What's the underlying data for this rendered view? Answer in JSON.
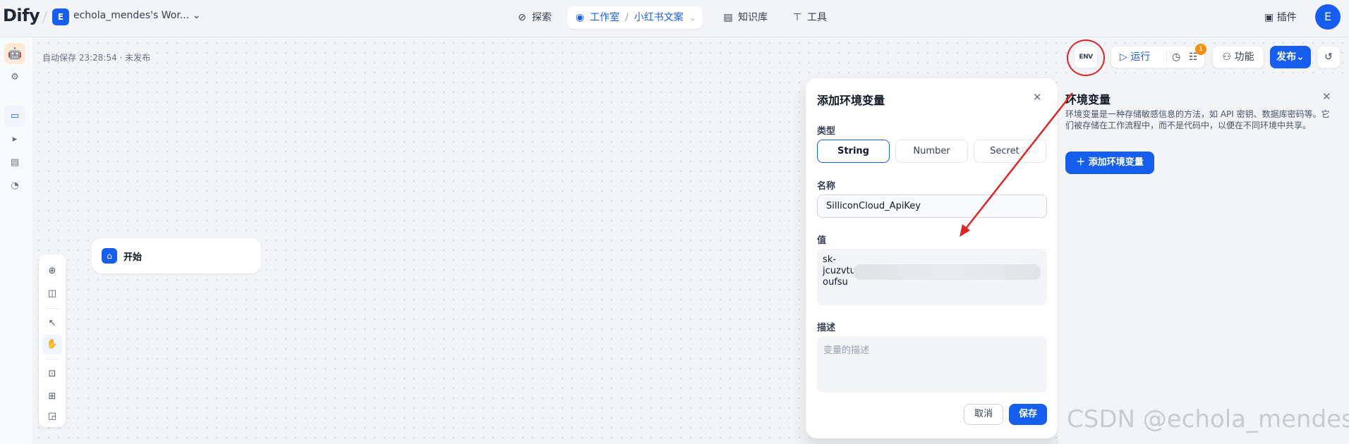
{
  "topbar": {
    "logo": "Dify",
    "workspace_initial": "E",
    "workspace_name": "echola_mendes's Wor...",
    "nav": {
      "explore": "探索",
      "studio": "工作室",
      "app_name": "小红书文案",
      "knowledge": "知识库",
      "tools": "工具"
    },
    "plugin": "插件",
    "user_initial": "E"
  },
  "canvas": {
    "autosave": "自动保存 23:28:54 · 未发布",
    "start_node": "开始"
  },
  "toolbar": {
    "env": "ENV",
    "run": "运行",
    "badge": "1",
    "features": "功能",
    "publish": "发布"
  },
  "dialog": {
    "title": "添加环境变量",
    "type_label": "类型",
    "types": [
      "String",
      "Number",
      "Secret"
    ],
    "selected_type": "String",
    "name_label": "名称",
    "name_value": "SilliconCloud_ApiKey",
    "value_label": "值",
    "value_lines": [
      "sk-",
      "jcuzvtu",
      "oufsu"
    ],
    "desc_label": "描述",
    "desc_placeholder": "变量的描述",
    "cancel": "取消",
    "save": "保存"
  },
  "env_panel": {
    "title": "环境变量",
    "description": "环境变量是一种存储敏感信息的方法，如 API 密钥、数据库密码等。它们被存储在工作流程中，而不是代码中，以便在不同环境中共享。",
    "add_button": "添加环境变量"
  },
  "watermark": "CSDN @echola_mendes"
}
